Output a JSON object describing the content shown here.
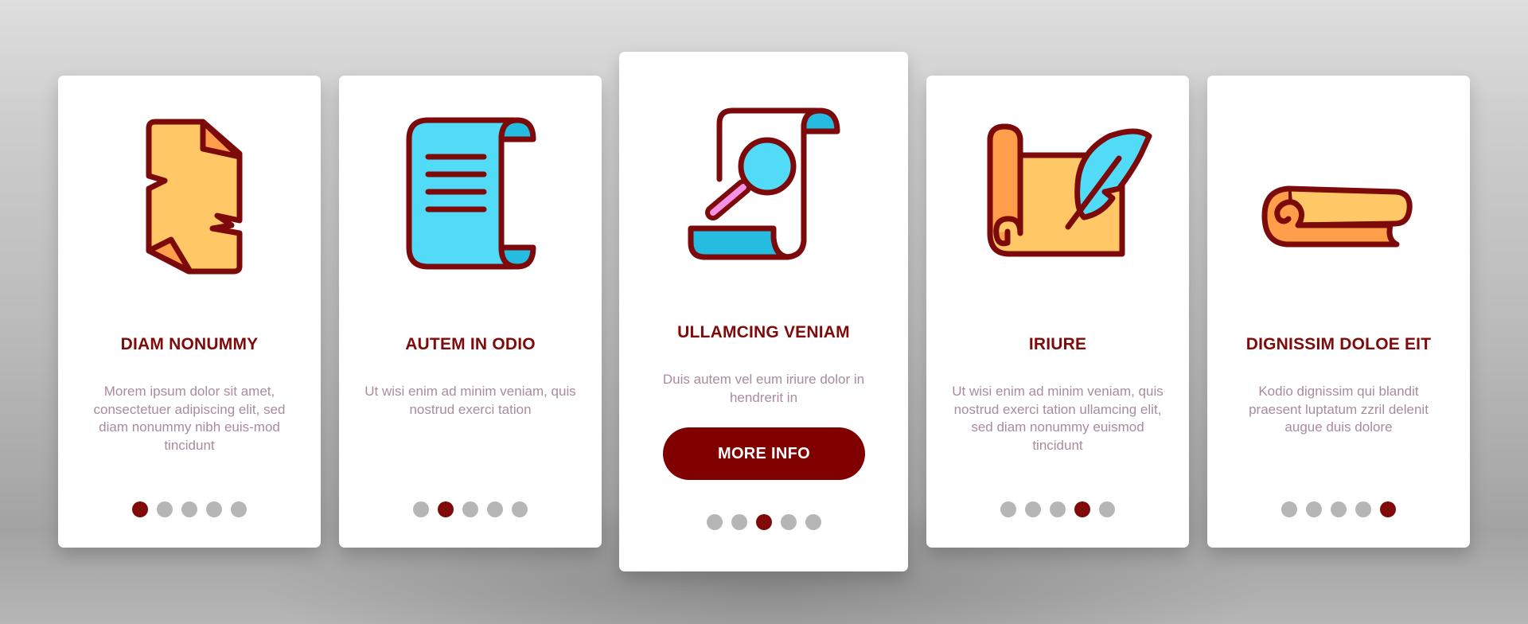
{
  "colors": {
    "accent": "#800000",
    "outline": "#7d0a0a",
    "dot_inactive": "#b6b6b6",
    "text_body": "#a98b9e",
    "paper_yellow": "#ffc766",
    "paper_orange": "#ff9e4a",
    "blue_light": "#52dbf7",
    "blue_dark": "#26bbe0",
    "pink": "#f592e6"
  },
  "cards": [
    {
      "icon": "torn-paper-icon",
      "title": "DIAM NONUMMY",
      "body": "Morem ipsum dolor sit amet, consectetuer adipiscing elit, sed diam nonummy nibh euis-mod tincidunt",
      "active_step": 1,
      "total_steps": 5
    },
    {
      "icon": "scroll-document-icon",
      "title": "AUTEM IN ODIO",
      "body": "Ut wisi enim ad minim veniam, quis nostrud exerci tation",
      "active_step": 2,
      "total_steps": 5
    },
    {
      "icon": "scroll-search-icon",
      "title": "ULLAMCING VENIAM",
      "body": "Duis autem vel eum iriure dolor in hendrerit in",
      "button_label": "MORE INFO",
      "active_step": 3,
      "total_steps": 5
    },
    {
      "icon": "scroll-quill-icon",
      "title": "IRIURE",
      "body": "Ut wisi enim ad minim veniam, quis nostrud exerci tation ullamcing elit, sed diam nonummy euismod tincidunt",
      "active_step": 4,
      "total_steps": 5
    },
    {
      "icon": "rolled-scroll-icon",
      "title": "DIGNISSIM DOLOE EIT",
      "body": "Kodio dignissim qui blandit praesent luptatum zzril delenit augue duis dolore",
      "active_step": 5,
      "total_steps": 5
    }
  ]
}
